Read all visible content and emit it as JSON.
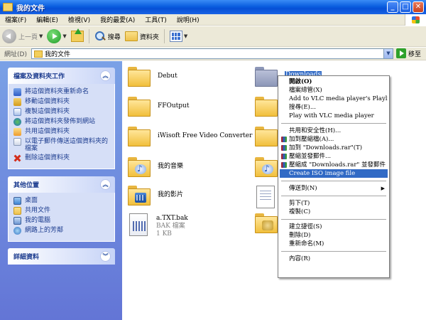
{
  "window": {
    "title": "我的文件"
  },
  "menubar": [
    "檔案(F)",
    "編輯(E)",
    "檢視(V)",
    "我的最愛(A)",
    "工具(T)",
    "說明(H)"
  ],
  "toolbar": {
    "back": "上一頁",
    "search": "搜尋",
    "folders": "資料夾"
  },
  "address": {
    "label": "網址(D)",
    "value": "我的文件",
    "go": "移至"
  },
  "tasks_panel": {
    "title": "檔案及資料夾工作",
    "items": [
      "將這個資料夾重新命名",
      "移動這個資料夾",
      "複製這個資料夾",
      "將這個資料夾發佈到網站",
      "共用這個資料夾",
      "以電子郵件傳送這個資料夾的檔案",
      "刪除這個資料夾"
    ]
  },
  "places_panel": {
    "title": "其他位置",
    "items": [
      "桌面",
      "共用文件",
      "我的電腦",
      "網路上的芳鄰"
    ]
  },
  "details_panel": {
    "title": "詳細資料"
  },
  "files": [
    {
      "name": "Debut"
    },
    {
      "name": "FFOutput"
    },
    {
      "name": "iWisoft Free Video Converter"
    },
    {
      "name": "我的音樂"
    },
    {
      "name": "我的影片"
    },
    {
      "name": "a.TXT.bak",
      "type": "BAK 檔案",
      "size": "1 KB"
    },
    {
      "name": "Downloads"
    }
  ],
  "context_menu": [
    {
      "label": "開啟(O)",
      "bold": true
    },
    {
      "label": "檔案總管(X)"
    },
    {
      "label": "Add to VLC media player's Playlist"
    },
    {
      "label": "搜尋(E)..."
    },
    {
      "label": "Play with VLC media player"
    },
    {
      "separator": true
    },
    {
      "label": "共用和安全性(H)..."
    },
    {
      "label": "加到壓縮檔(A)...",
      "rar": true
    },
    {
      "label": "加到 \"Downloads.rar\"(T)",
      "rar": true
    },
    {
      "label": "壓縮並發郵件...",
      "rar": true
    },
    {
      "label": "壓縮成 \"Downloads.rar\" 並發郵件",
      "rar": true
    },
    {
      "label": "Create ISO image file",
      "highlighted": true
    },
    {
      "separator": true
    },
    {
      "label": "傳送到(N)",
      "submenu": true
    },
    {
      "separator": true
    },
    {
      "label": "剪下(T)"
    },
    {
      "label": "複製(C)"
    },
    {
      "separator": true
    },
    {
      "label": "建立捷徑(S)"
    },
    {
      "label": "刪除(D)"
    },
    {
      "label": "重新命名(M)"
    },
    {
      "separator": true
    },
    {
      "label": "內容(R)"
    }
  ]
}
